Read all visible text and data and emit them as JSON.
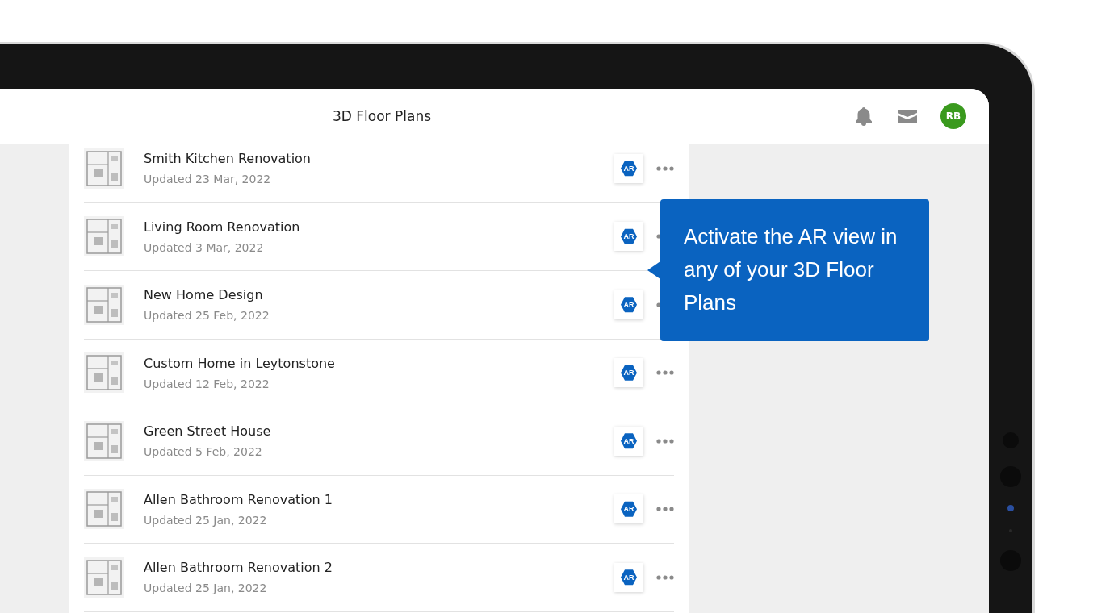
{
  "header": {
    "title": "3D Floor Plans",
    "user_initials": "RB"
  },
  "projects": [
    {
      "title": "Smith Kitchen Renovation",
      "updated": "Updated 23 Mar, 2022",
      "ar_label": "AR"
    },
    {
      "title": "Living Room Renovation",
      "updated": "Updated 3 Mar, 2022",
      "ar_label": "AR"
    },
    {
      "title": "New Home Design",
      "updated": "Updated 25 Feb, 2022",
      "ar_label": "AR"
    },
    {
      "title": "Custom Home in Leytonstone",
      "updated": "Updated 12 Feb, 2022",
      "ar_label": "AR"
    },
    {
      "title": "Green Street House",
      "updated": "Updated 5 Feb, 2022",
      "ar_label": "AR"
    },
    {
      "title": "Allen Bathroom Renovation 1",
      "updated": "Updated 25 Jan, 2022",
      "ar_label": "AR"
    },
    {
      "title": "Allen Bathroom Renovation 2",
      "updated": "Updated 25 Jan, 2022",
      "ar_label": "AR"
    }
  ],
  "tooltip": {
    "text": "Activate the AR view in any of your 3D Floor Plans"
  }
}
